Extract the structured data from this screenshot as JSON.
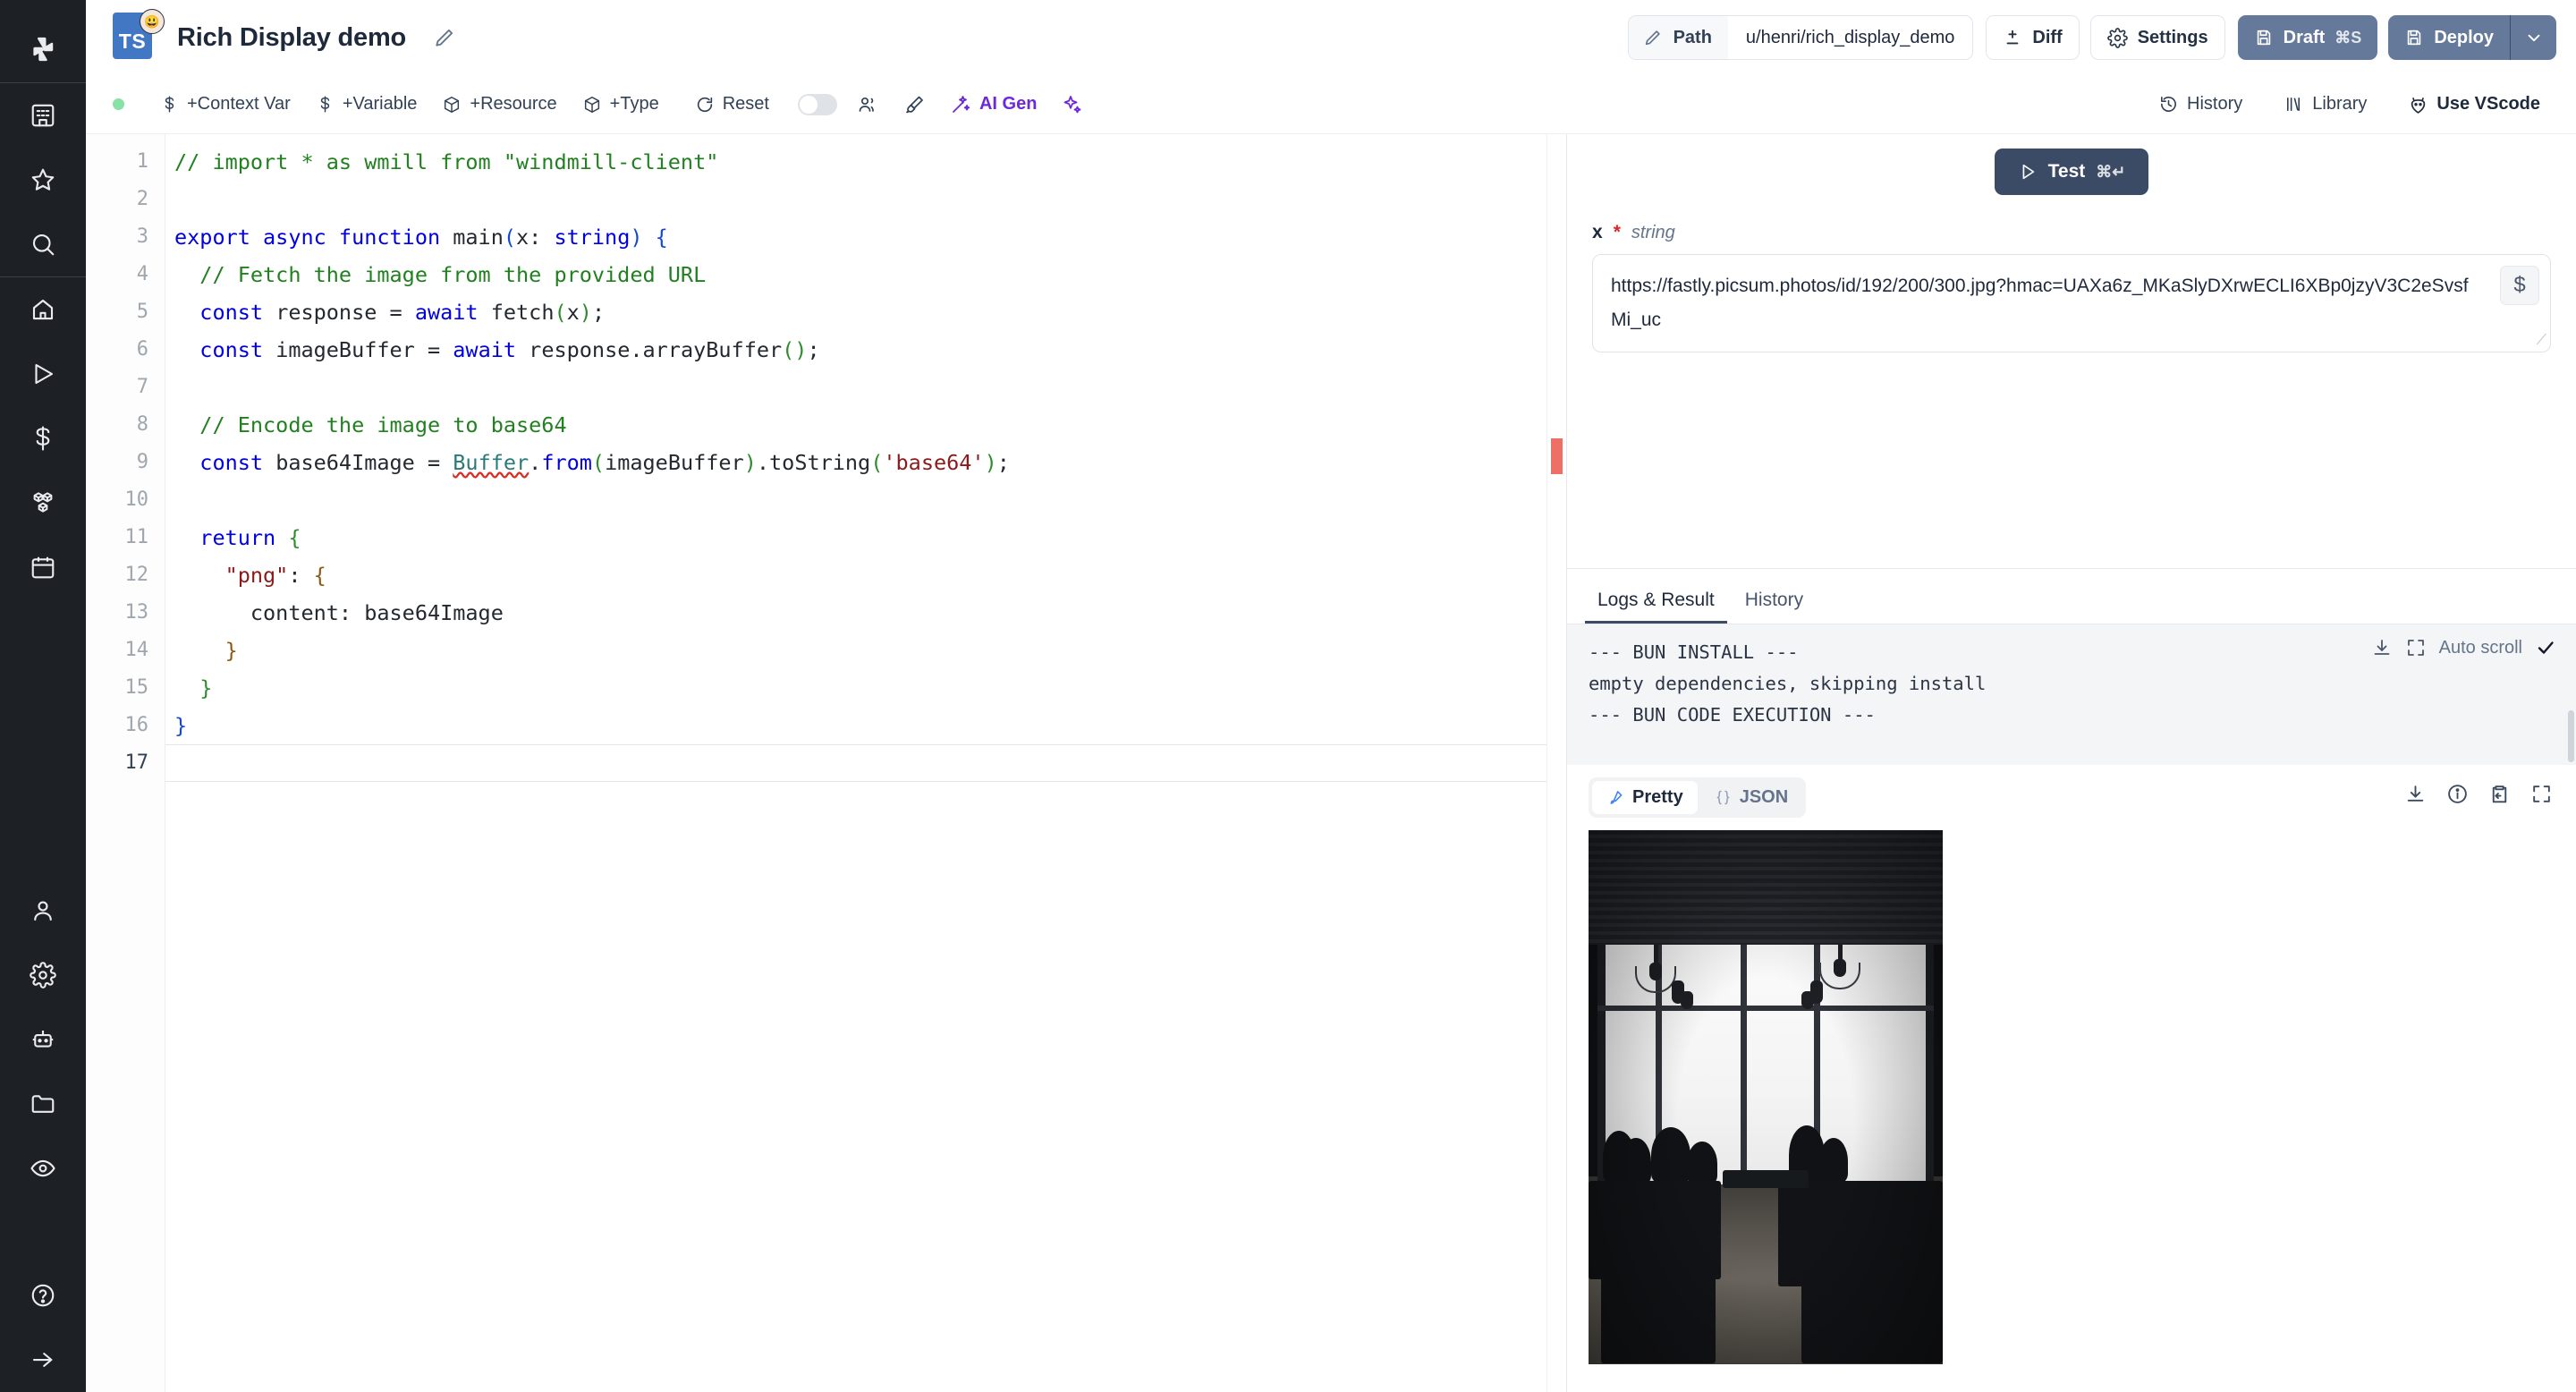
{
  "sidebar": {
    "logo_icon": "windmill-logo-icon",
    "top_items": [
      {
        "icon": "workspace-grid-icon",
        "name": "sidebar-item-workspace"
      },
      {
        "icon": "star-icon",
        "name": "sidebar-item-favorites"
      },
      {
        "icon": "search-icon",
        "name": "sidebar-item-search"
      }
    ],
    "nav_items": [
      {
        "icon": "home-icon",
        "name": "sidebar-item-home"
      },
      {
        "icon": "play-icon",
        "name": "sidebar-item-runs"
      },
      {
        "icon": "dollar-icon",
        "name": "sidebar-item-variables"
      },
      {
        "icon": "boxes-icon",
        "name": "sidebar-item-resources"
      },
      {
        "icon": "calendar-icon",
        "name": "sidebar-item-schedules"
      }
    ],
    "bottom_items": [
      {
        "icon": "user-icon",
        "name": "sidebar-item-account"
      },
      {
        "icon": "gear-icon",
        "name": "sidebar-item-settings"
      },
      {
        "icon": "robot-icon",
        "name": "sidebar-item-workers"
      },
      {
        "icon": "folder-icon",
        "name": "sidebar-item-folders"
      },
      {
        "icon": "eye-icon",
        "name": "sidebar-item-audit-logs"
      }
    ],
    "help_items": [
      {
        "icon": "help-circle-icon",
        "name": "sidebar-item-help"
      },
      {
        "icon": "arrow-right-icon",
        "name": "sidebar-expand-button"
      }
    ]
  },
  "header": {
    "language_badge": "TS",
    "avatar_emoji": "😃",
    "title": "Rich Display demo",
    "edit_title_icon": "pencil-icon",
    "path_icon": "pencil-icon",
    "path_label": "Path",
    "path_value": "u/henri/rich_display_demo",
    "diff_label": "Diff",
    "settings_label": "Settings",
    "draft_label": "Draft",
    "draft_shortcut": "⌘S",
    "deploy_label": "Deploy"
  },
  "toolbar": {
    "status_dot_color": "#86e2a5",
    "items": [
      {
        "icon": "dollar-icon",
        "label": "+Context Var"
      },
      {
        "icon": "dollar-icon",
        "label": "+Variable"
      },
      {
        "icon": "box-icon",
        "label": "+Resource"
      },
      {
        "icon": "box-icon",
        "label": "+Type"
      },
      {
        "icon": "reset-icon",
        "label": "Reset"
      }
    ],
    "toggle_on": false,
    "users_icon": "users-icon",
    "brush_icon": "brush-icon",
    "ai_gen_label": "AI Gen",
    "ai_gen_color": "#6d28d9",
    "sparkles_icon": "sparkles-icon",
    "right_items": [
      {
        "icon": "history-icon",
        "label": "History"
      },
      {
        "icon": "library-icon",
        "label": "Library"
      },
      {
        "icon": "vscode-cat-icon",
        "label": "Use VScode"
      }
    ]
  },
  "editor": {
    "active_line": 17,
    "line_numbers": [
      1,
      2,
      3,
      4,
      5,
      6,
      7,
      8,
      9,
      10,
      11,
      12,
      13,
      14,
      15,
      16,
      17
    ],
    "error_marker_color": "#ee6f66",
    "code_lines": [
      "// import * as wmill from \"windmill-client\"",
      "",
      "export async function main(x: string) {",
      "  // Fetch the image from the provided URL",
      "  const response = await fetch(x);",
      "  const imageBuffer = await response.arrayBuffer();",
      "",
      "  // Encode the image to base64",
      "  const base64Image = Buffer.from(imageBuffer).toString('base64');",
      "",
      "  return {",
      "    \"png\": {",
      "      content: base64Image",
      "    }",
      "  }",
      "}",
      ""
    ]
  },
  "testpanel": {
    "test_label": "Test",
    "test_shortcut": "⌘↵",
    "play_icon": "play-icon",
    "arg_name": "x",
    "arg_required": "*",
    "arg_type": "string",
    "arg_value": "https://fastly.picsum.photos/id/192/200/300.jpg?hmac=UAXa6z_MKaSlyDXrwECLI6XBp0jzyV3C2eSvsfMi_uc",
    "dollar_button_icon": "dollar-icon"
  },
  "results": {
    "tabs": [
      {
        "label": "Logs & Result",
        "active": true
      },
      {
        "label": "History",
        "active": false
      }
    ],
    "log_lines": [
      "--- BUN INSTALL ---",
      "empty dependencies, skipping install",
      "--- BUN CODE EXECUTION ---"
    ],
    "log_controls": {
      "download_icon": "download-icon",
      "expand_icon": "expand-icon",
      "auto_scroll_label": "Auto scroll",
      "auto_scroll_checked": true,
      "check_icon": "check-icon"
    },
    "view_modes": [
      {
        "label": "Pretty",
        "icon": "highlighter-icon",
        "active": true
      },
      {
        "label": "JSON",
        "icon": "braces-icon",
        "active": false
      }
    ],
    "result_controls": [
      {
        "icon": "download-icon"
      },
      {
        "icon": "info-icon"
      },
      {
        "icon": "clipboard-icon"
      },
      {
        "icon": "expand-icon"
      }
    ],
    "result_image": "black-and-white-cafe-interior-photo"
  }
}
